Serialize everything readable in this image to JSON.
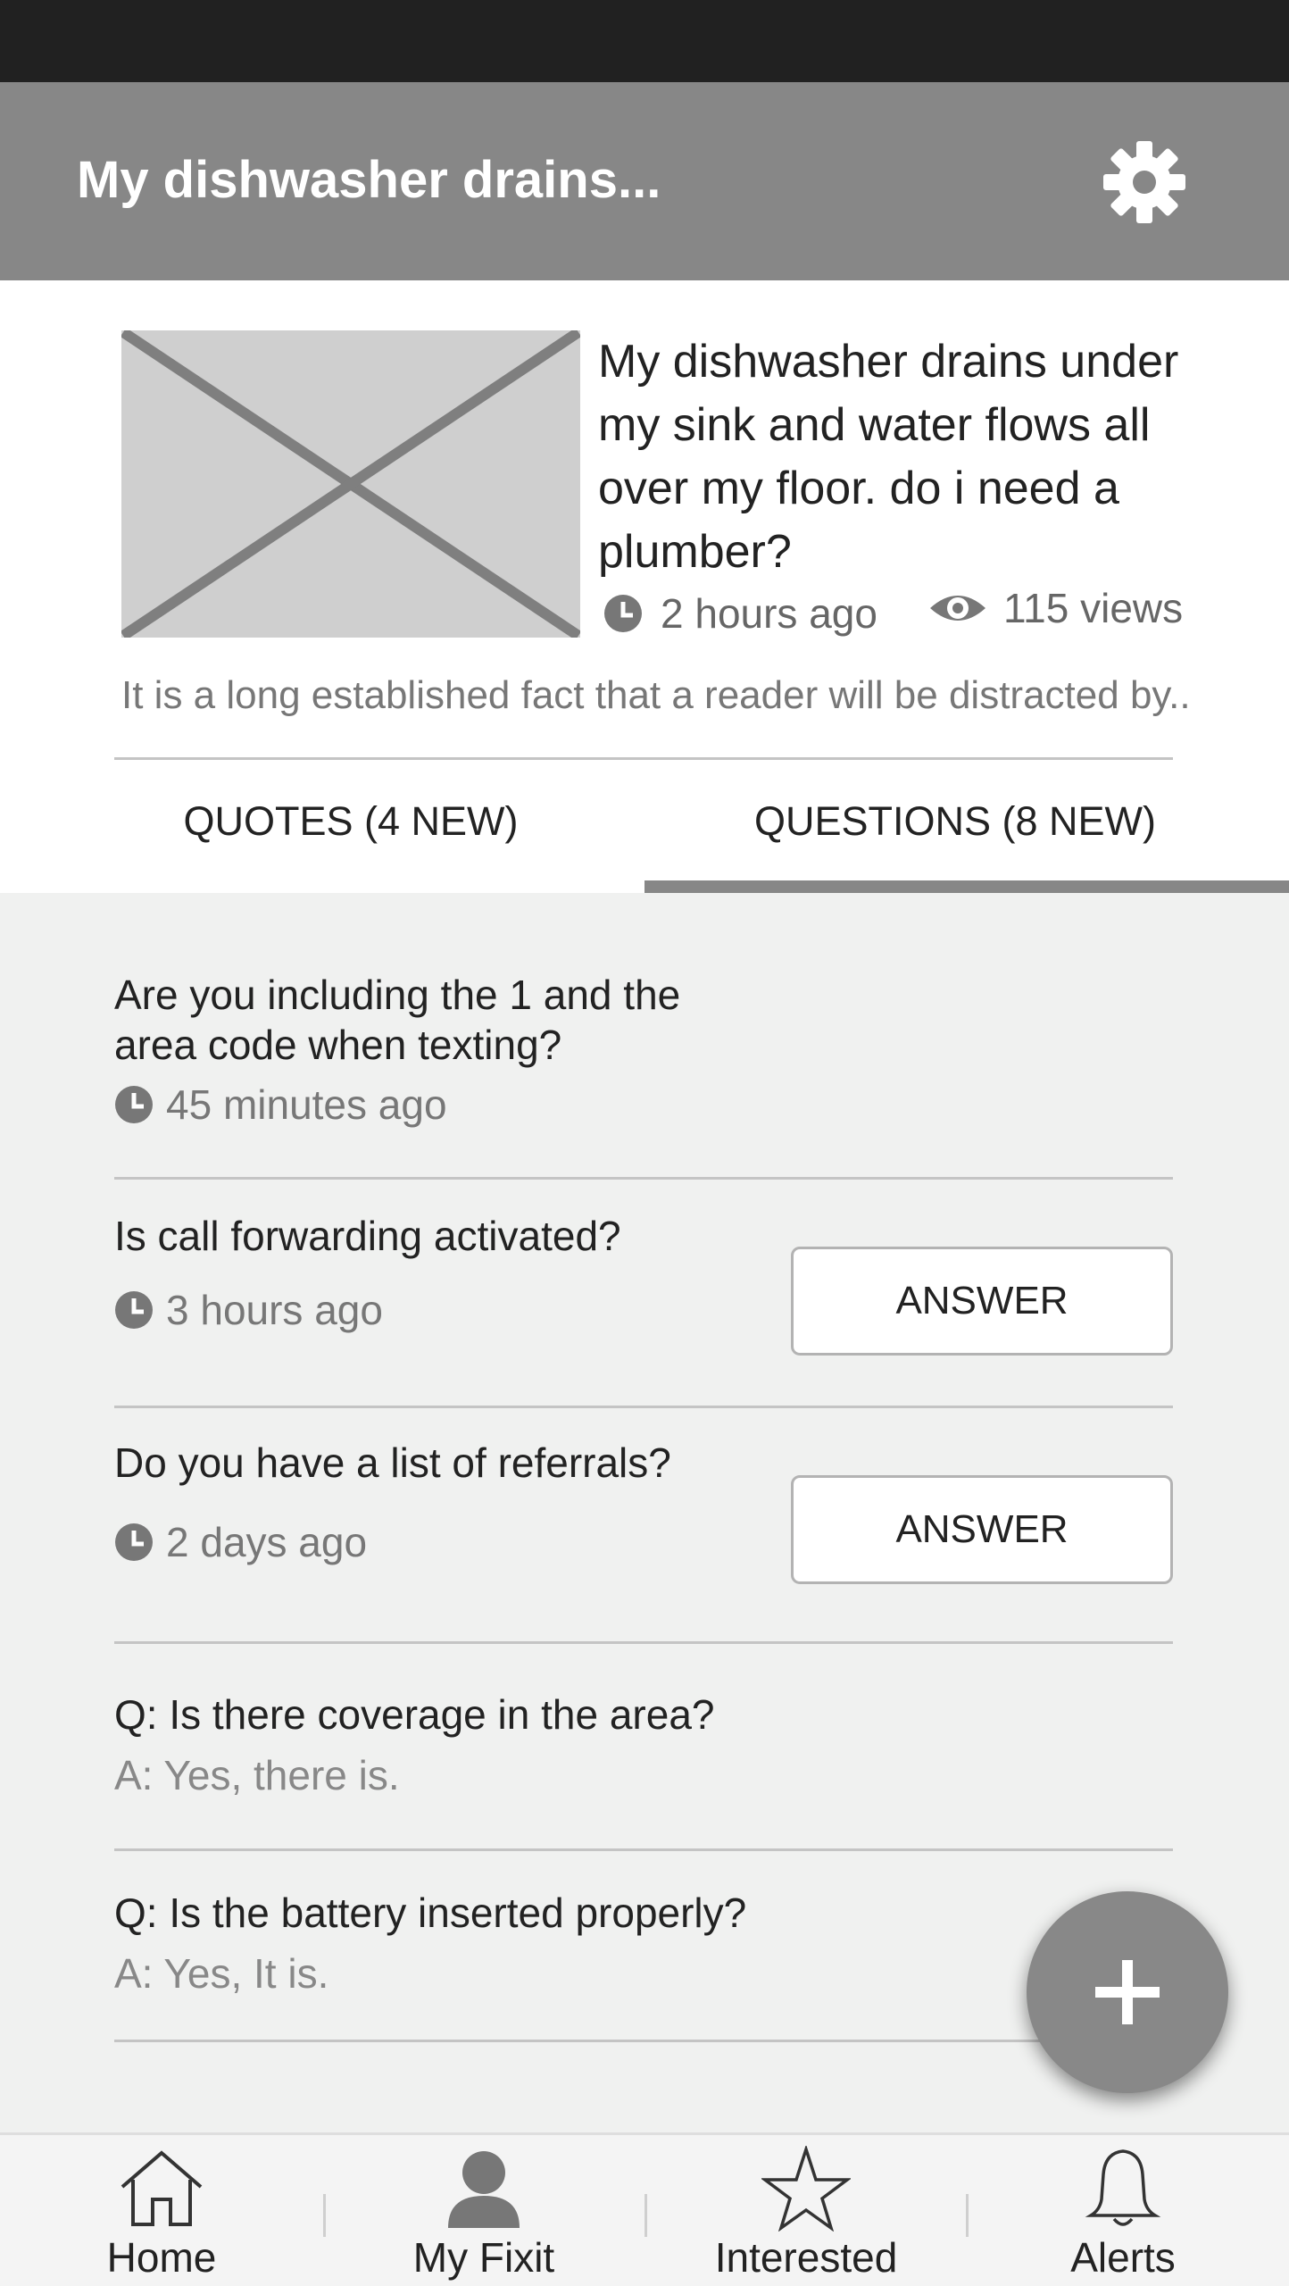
{
  "app_bar": {
    "title": "My dishwasher drains...",
    "settings_icon": "gear-icon"
  },
  "post": {
    "thumbnail_icon": "image-placeholder",
    "title": "My dishwasher drains under my sink and water flows all over my floor. do i need a plumber?",
    "time": "2 hours ago",
    "views": "115 views",
    "excerpt": "It is a long established fact that a reader will be distracted by..."
  },
  "tabs": [
    {
      "label": "QUOTES (4 NEW)",
      "active": false
    },
    {
      "label": "QUESTIONS (8 NEW)",
      "active": true
    }
  ],
  "questions": [
    {
      "text": "Are you including the 1 and the area code when texting?",
      "time": "45 minutes ago"
    },
    {
      "text": "Is call forwarding activated?",
      "time": "3 hours ago",
      "action": "ANSWER"
    },
    {
      "text": "Do you have a list of referrals?",
      "time": "2 days ago",
      "action": "ANSWER"
    }
  ],
  "answered": [
    {
      "q": "Q:  Is there coverage in the area?",
      "a": "A:  Yes, there is."
    },
    {
      "q": "Q:  Is the battery inserted properly?",
      "a": "A:  Yes, It is."
    }
  ],
  "fab_icon": "plus-icon",
  "bottom_nav": [
    {
      "label": "Home",
      "icon": "home-icon"
    },
    {
      "label": "My Fixit",
      "icon": "person-icon"
    },
    {
      "label": "Interested",
      "icon": "star-icon"
    },
    {
      "label": "Alerts",
      "icon": "bell-icon"
    }
  ],
  "colors": {
    "status_bar": "#212121",
    "app_bar": "#878787",
    "content_bg": "#f0f1f0",
    "tab_indicator": "#878787",
    "fab": "#888888"
  }
}
